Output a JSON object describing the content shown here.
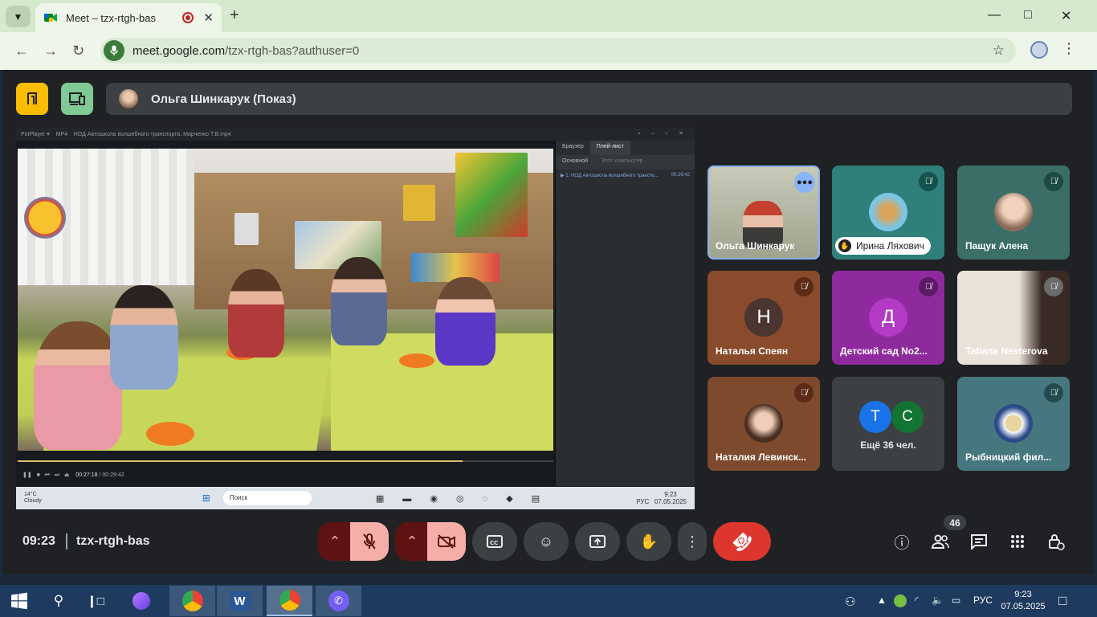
{
  "browser": {
    "tab_title": "Meet – tzx-rtgh-bas",
    "new_tab": "+",
    "url_host": "meet.google.com",
    "url_path": "/tzx-rtgh-bas?authuser=0"
  },
  "presenter": {
    "name": "Ольга Шинкарук (Показ)"
  },
  "shared_screen": {
    "player_name": "PotPlayer",
    "format": "MP4",
    "file_title": "НОД Автошкола волшебного транспорта. Марченко Т.В.mp4",
    "playlist_tab_browser": "Браузер",
    "playlist_tab_list": "Плей-лист",
    "playlist_sub_main": "Основной",
    "playlist_sub_pc": "Этот компьютер",
    "playlist_item": "1. НОД Автошкола волшебного транспо...",
    "playlist_item_time": "00:29:42",
    "time_current": "00:27:18",
    "time_total": "00:29:42",
    "weather_temp": "14°C",
    "weather_text": "Cloudy",
    "win_search": "Поиск",
    "win_lang": "РУС",
    "win_time": "9:23",
    "win_date": "07.05.2025"
  },
  "participants": [
    {
      "name": "Ольга Шинкарук"
    },
    {
      "name": "Ирина Ляхович"
    },
    {
      "name": "Пащук Алена"
    },
    {
      "name": "Наталья Спеян",
      "initial": "Н"
    },
    {
      "name": "Детский сад No2...",
      "initial": "Д"
    },
    {
      "name": "Tatiana Nesterova"
    },
    {
      "name": "Наталия Левинск..."
    },
    {
      "name": "Ещё 36 чел.",
      "initial_a": "Т",
      "initial_b": "С"
    },
    {
      "name": "Рыбницкий фил..."
    }
  ],
  "meeting": {
    "time": "09:23",
    "code": "tzx-rtgh-bas",
    "people_count": "46"
  },
  "taskbar": {
    "lang": "РУС",
    "time": "9:23",
    "date": "07.05.2025"
  },
  "colors": {
    "end_call": "#dc362e",
    "muted_bg": "#f6aea9",
    "meet_bg": "#202124",
    "tile_muted_badge": "#5c1313"
  },
  "icons": [
    "chevron-down-icon",
    "meet-favicon",
    "record-icon",
    "close-icon",
    "back-icon",
    "forward-icon",
    "reload-icon",
    "mic-site-icon",
    "star-icon",
    "more-icon",
    "minimize-icon",
    "maximize-icon",
    "mic-off-icon",
    "camera-off-icon",
    "captions-icon",
    "emoji-icon",
    "present-icon",
    "hand-icon",
    "end-call-icon",
    "info-icon",
    "people-icon",
    "chat-icon",
    "activities-icon",
    "host-controls-icon"
  ]
}
